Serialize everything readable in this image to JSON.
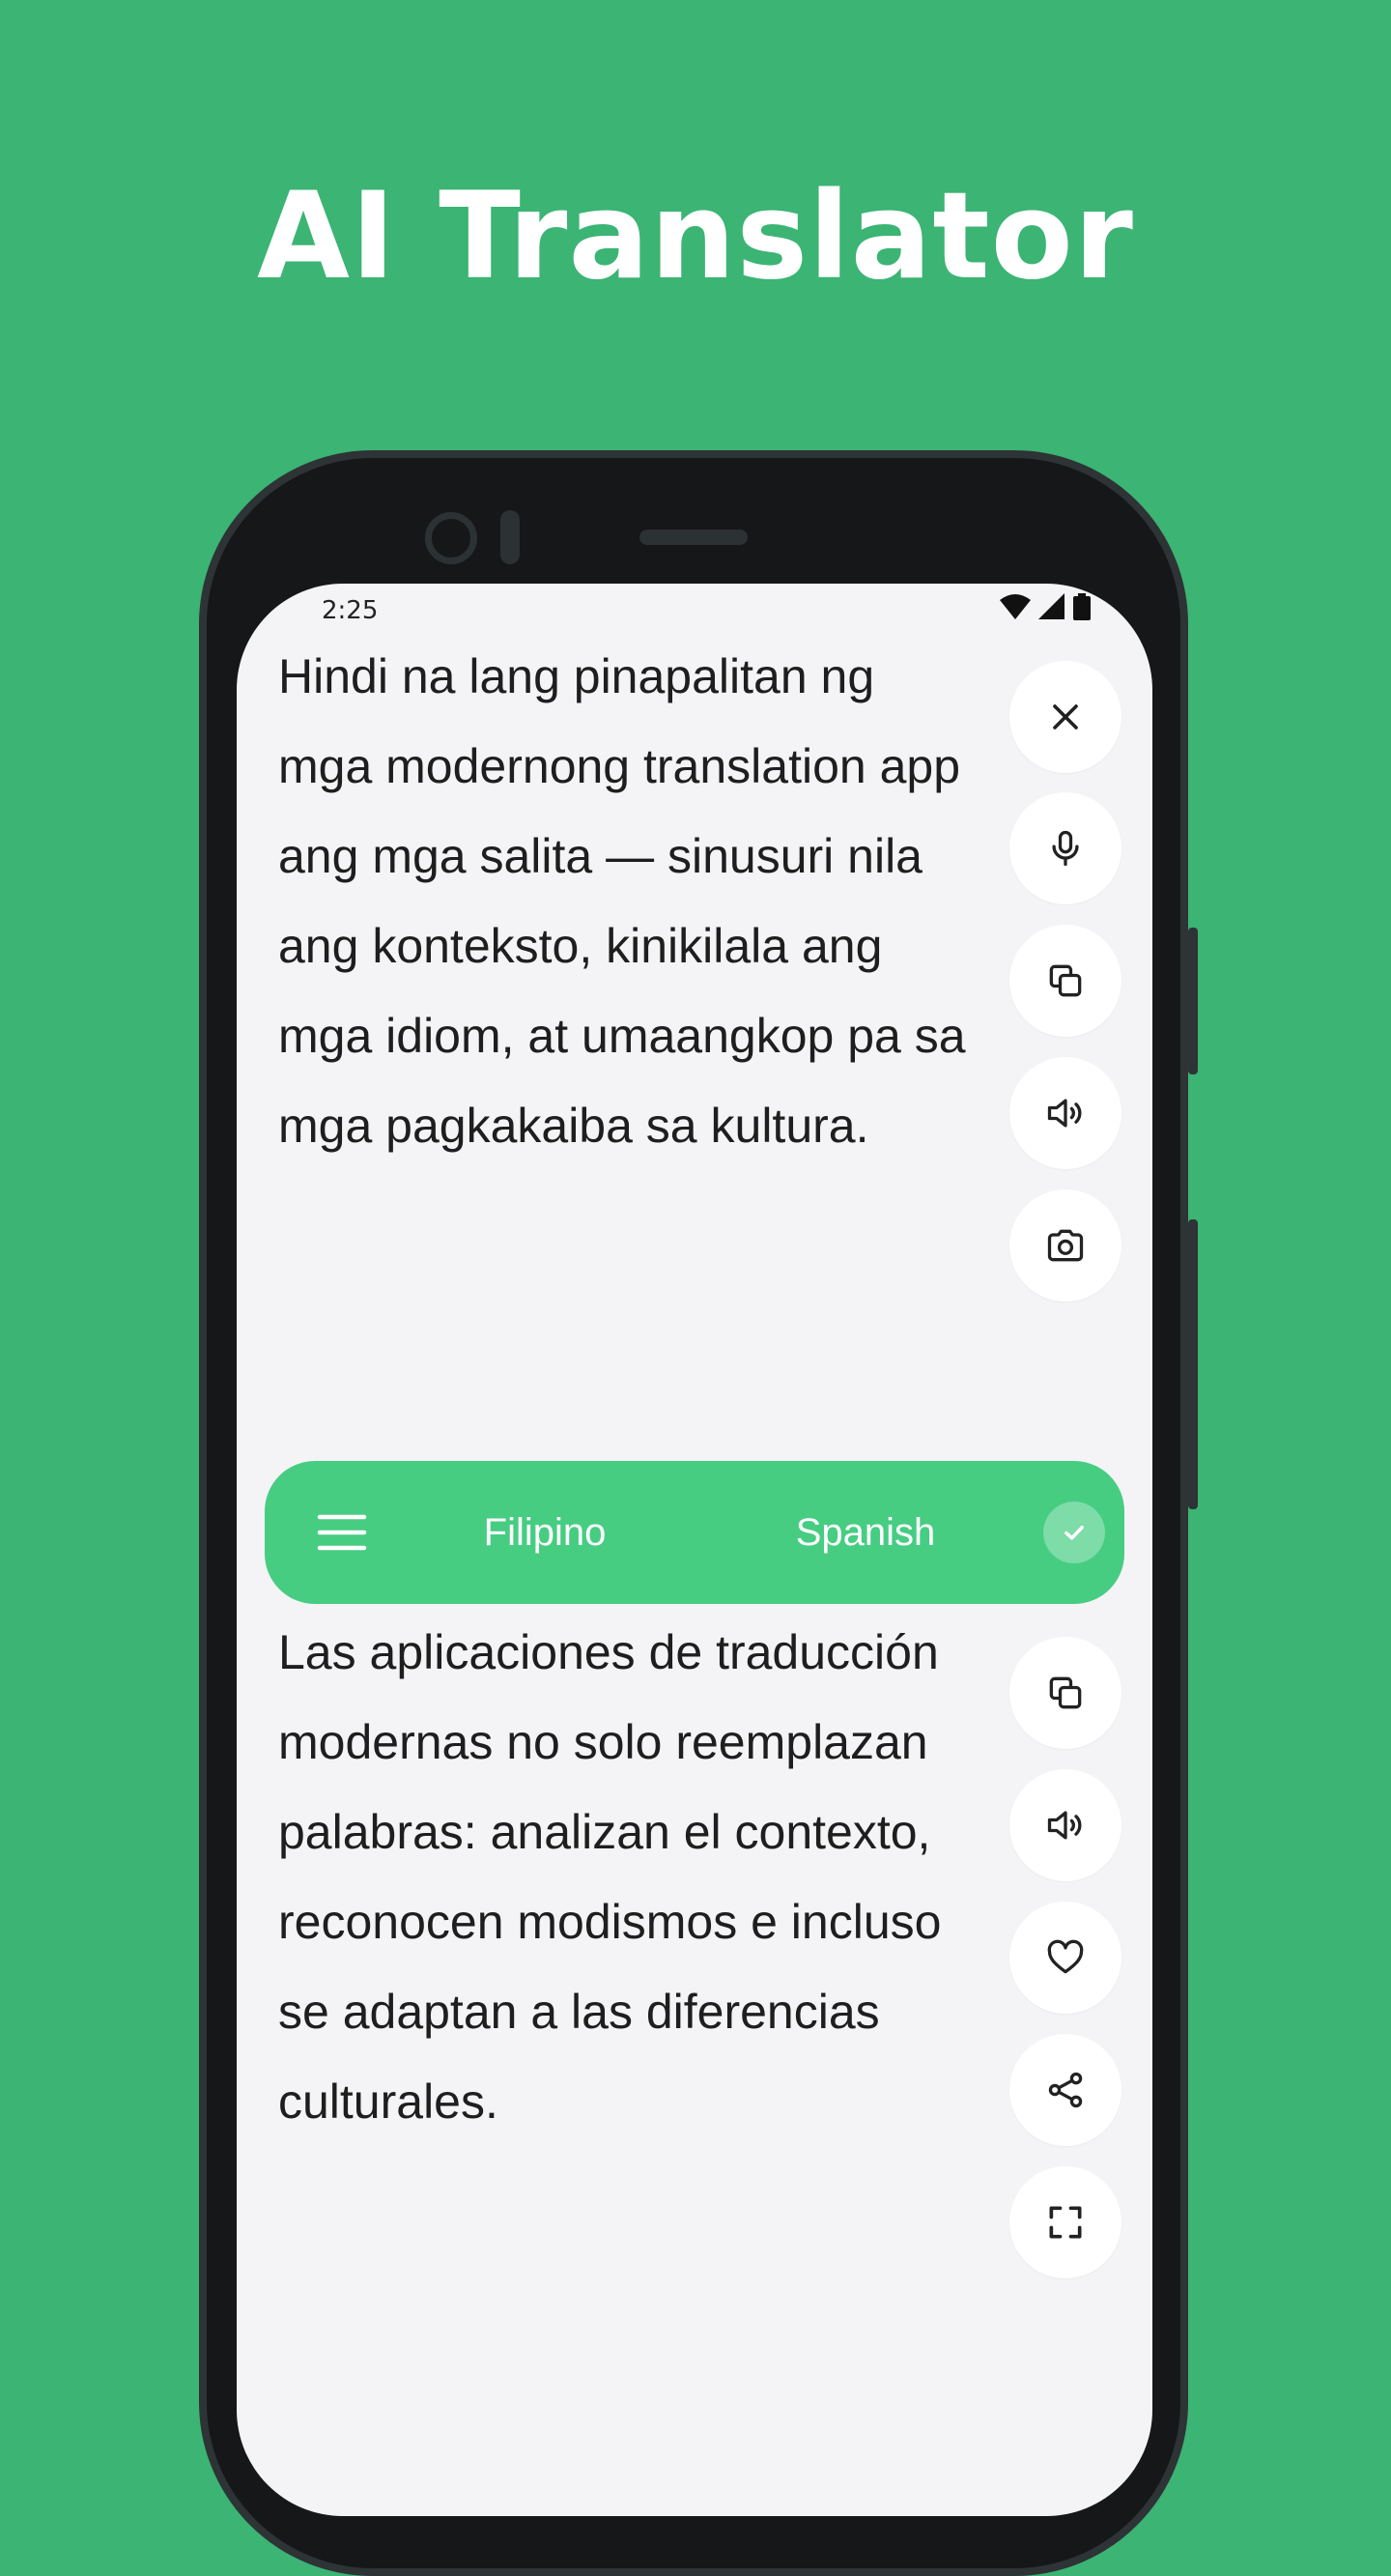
{
  "promo": {
    "headline": "AI Translator"
  },
  "status_bar": {
    "time": "2:25"
  },
  "source": {
    "text": "Hindi na lang pinapalitan ng mga modernong translation app ang mga salita — sinusuri nila ang konteksto, kinikilala ang mga idiom, at umaangkop pa sa mga pagkakaiba sa kultura.",
    "actions": [
      "close-icon",
      "microphone-icon",
      "copy-icon",
      "speaker-icon",
      "camera-icon"
    ]
  },
  "language_bar": {
    "source_language": "Filipino",
    "target_language": "Spanish",
    "icons": [
      "menu-icon",
      "check-icon"
    ]
  },
  "target": {
    "text": "Las aplicaciones de traducción modernas no solo reemplazan palabras: analizan el contexto, reconocen modismos e incluso se adaptan a las diferencias culturales.",
    "actions": [
      "copy-icon",
      "speaker-icon",
      "heart-icon",
      "share-icon",
      "fullscreen-icon"
    ]
  },
  "colors": {
    "background": "#3BB474",
    "accent": "#46CD82",
    "screen": "#F4F4F6",
    "text": "#1E1E1E"
  }
}
